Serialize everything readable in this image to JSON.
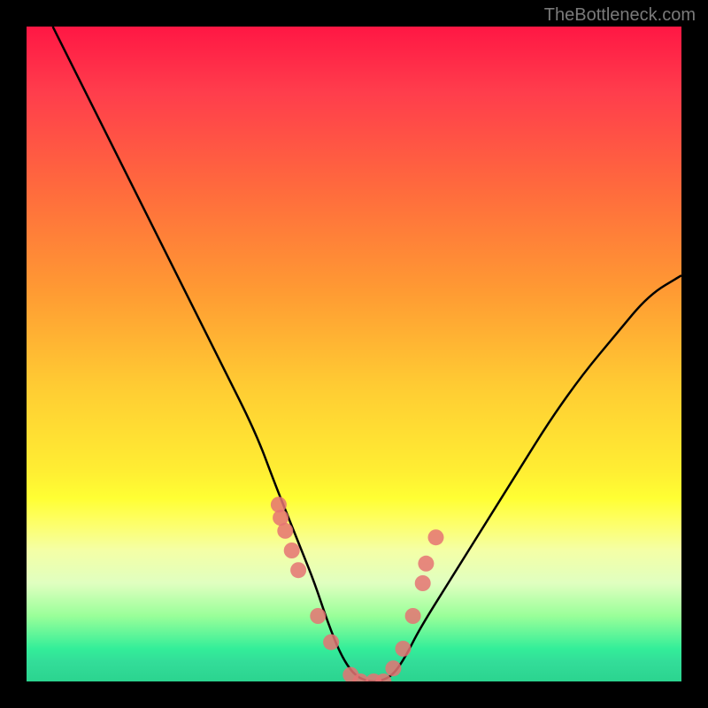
{
  "watermark": "TheBottleneck.com",
  "chart_data": {
    "type": "line",
    "title": "",
    "xlabel": "",
    "ylabel": "",
    "xlim": [
      0,
      100
    ],
    "ylim": [
      0,
      100
    ],
    "grid": false,
    "series": [
      {
        "name": "bottleneck-curve",
        "x": [
          4,
          10,
          15,
          20,
          25,
          30,
          35,
          38,
          40,
          42,
          44,
          46,
          48,
          50,
          52,
          54,
          56,
          58,
          60,
          65,
          70,
          75,
          80,
          85,
          90,
          95,
          100
        ],
        "y": [
          100,
          88,
          78,
          68,
          58,
          48,
          38,
          30,
          25,
          20,
          15,
          9,
          4,
          1,
          0,
          0,
          1,
          4,
          8,
          16,
          24,
          32,
          40,
          47,
          53,
          59,
          62
        ]
      }
    ],
    "markers": {
      "name": "highlight-points",
      "x": [
        38.5,
        38.8,
        39.5,
        40.5,
        41.5,
        44.5,
        46.5,
        49.5,
        51.0,
        53.0,
        54.5,
        56.0,
        57.5,
        59.0,
        60.5,
        61.0,
        62.5
      ],
      "y": [
        27,
        25,
        23,
        20,
        17,
        10,
        6,
        1,
        0,
        0,
        0,
        2,
        5,
        10,
        15,
        18,
        22
      ]
    },
    "gradient_stops": [
      {
        "pos": 0.0,
        "color": "#ff1744"
      },
      {
        "pos": 0.4,
        "color": "#ff9933"
      },
      {
        "pos": 0.72,
        "color": "#ffff33"
      },
      {
        "pos": 0.95,
        "color": "#33ee99"
      },
      {
        "pos": 1.0,
        "color": "#2bd48f"
      }
    ]
  }
}
